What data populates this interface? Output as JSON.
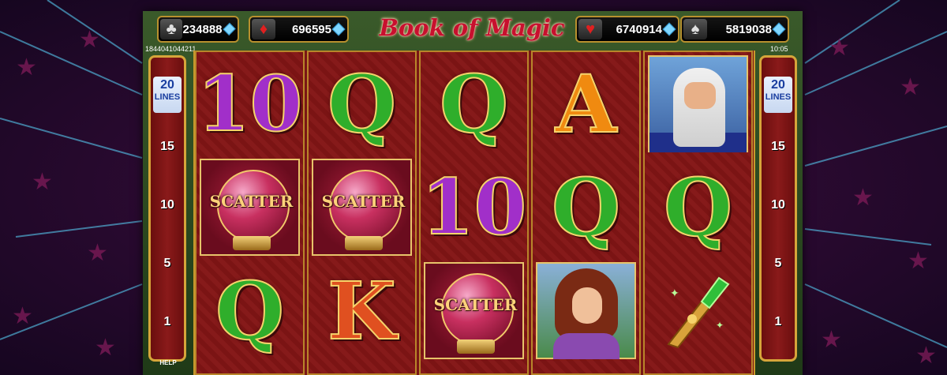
{
  "game": {
    "logo_text": "Book of Magic",
    "ticket_id": "1844041044211",
    "clock": "10:05",
    "help_label": "HELP"
  },
  "jackpots": [
    {
      "suit": "clubs",
      "symbol": "♣",
      "value": "234888",
      "color": "#e0e0e0"
    },
    {
      "suit": "diamonds",
      "symbol": "♦",
      "value": "696595",
      "color": "#e02020"
    },
    {
      "suit": "hearts",
      "symbol": "♥",
      "value": "6740914",
      "color": "#e02020"
    },
    {
      "suit": "spades",
      "symbol": "♠",
      "value": "5819038",
      "color": "#e0e0e0"
    }
  ],
  "lines": {
    "count": "20",
    "label": "LINES",
    "markers": [
      "15",
      "10",
      "5",
      "1"
    ]
  },
  "reels": [
    [
      {
        "type": "letter",
        "text": "10",
        "color": "purple"
      },
      {
        "type": "scatter",
        "text": "SCATTER"
      },
      {
        "type": "letter",
        "text": "Q",
        "color": "green"
      }
    ],
    [
      {
        "type": "letter",
        "text": "Q",
        "color": "green"
      },
      {
        "type": "scatter",
        "text": "SCATTER"
      },
      {
        "type": "letter",
        "text": "K",
        "color": "red"
      }
    ],
    [
      {
        "type": "letter",
        "text": "Q",
        "color": "green"
      },
      {
        "type": "letter",
        "text": "10",
        "color": "purple"
      },
      {
        "type": "scatter",
        "text": "SCATTER"
      }
    ],
    [
      {
        "type": "letter",
        "text": "A",
        "color": "orange"
      },
      {
        "type": "letter",
        "text": "Q",
        "color": "green"
      },
      {
        "type": "woman",
        "text": ""
      }
    ],
    [
      {
        "type": "wizard",
        "text": ""
      },
      {
        "type": "letter",
        "text": "Q",
        "color": "green"
      },
      {
        "type": "wand",
        "text": ""
      }
    ]
  ],
  "colors": {
    "frame_gold": "#c9992c",
    "reel_red": "#7a1616",
    "logo_red": "#c8102e"
  }
}
